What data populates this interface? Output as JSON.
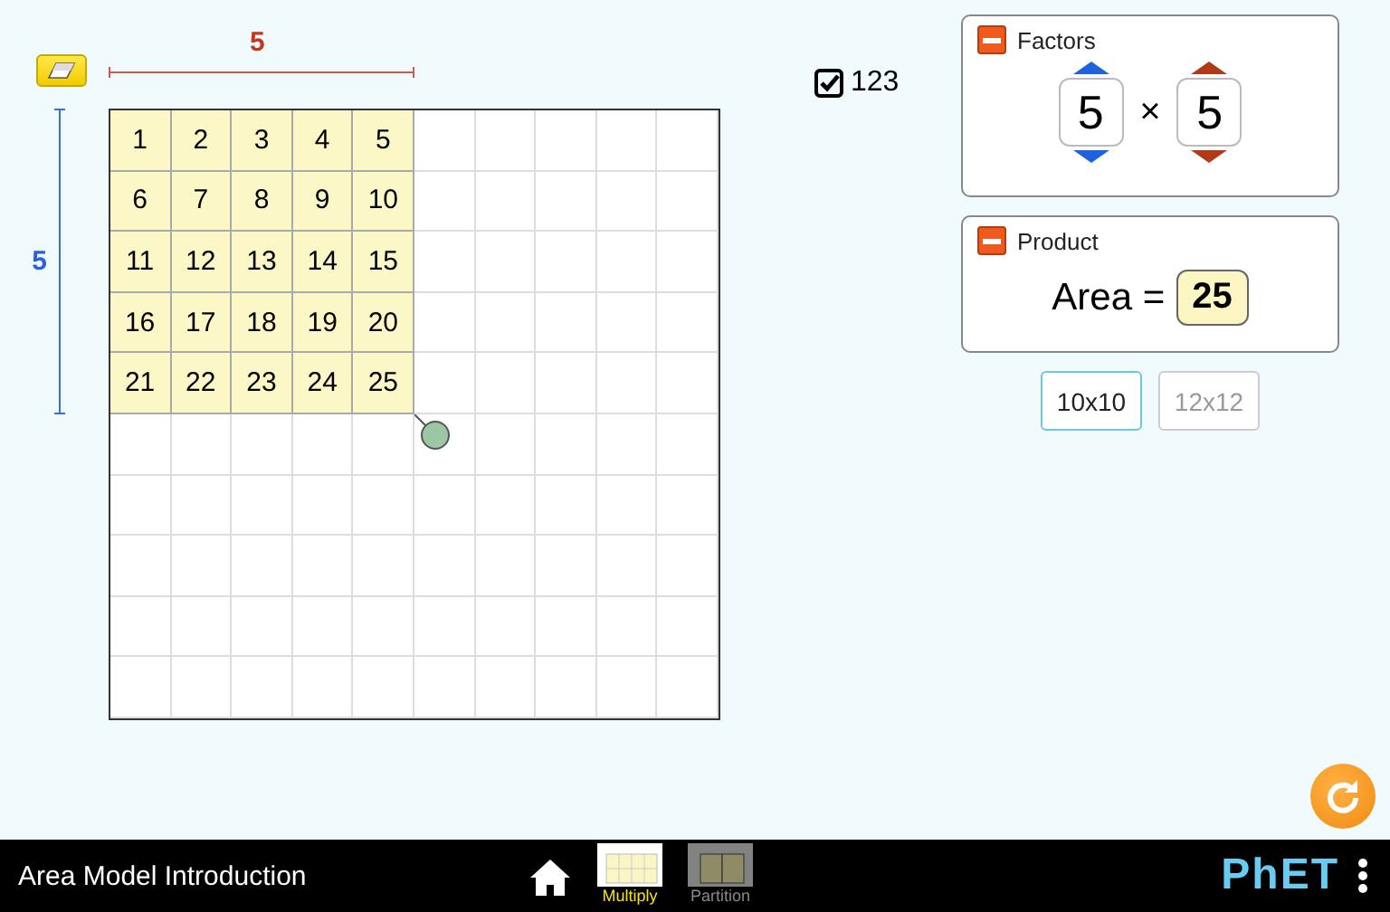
{
  "dimensions": {
    "width_label": "5",
    "height_label": "5"
  },
  "toggle": {
    "label": "123",
    "checked": true
  },
  "grid": {
    "rows": [
      [
        {
          "label": "1",
          "filled": true
        },
        {
          "label": "2",
          "filled": true
        },
        {
          "label": "3",
          "filled": true
        },
        {
          "label": "4",
          "filled": true
        },
        {
          "label": "5",
          "filled": true
        },
        {
          "filled": false
        },
        {
          "filled": false
        },
        {
          "filled": false
        },
        {
          "filled": false
        },
        {
          "filled": false
        }
      ],
      [
        {
          "label": "6",
          "filled": true
        },
        {
          "label": "7",
          "filled": true
        },
        {
          "label": "8",
          "filled": true
        },
        {
          "label": "9",
          "filled": true
        },
        {
          "label": "10",
          "filled": true
        },
        {
          "filled": false
        },
        {
          "filled": false
        },
        {
          "filled": false
        },
        {
          "filled": false
        },
        {
          "filled": false
        }
      ],
      [
        {
          "label": "11",
          "filled": true
        },
        {
          "label": "12",
          "filled": true
        },
        {
          "label": "13",
          "filled": true
        },
        {
          "label": "14",
          "filled": true
        },
        {
          "label": "15",
          "filled": true
        },
        {
          "filled": false
        },
        {
          "filled": false
        },
        {
          "filled": false
        },
        {
          "filled": false
        },
        {
          "filled": false
        }
      ],
      [
        {
          "label": "16",
          "filled": true
        },
        {
          "label": "17",
          "filled": true
        },
        {
          "label": "18",
          "filled": true
        },
        {
          "label": "19",
          "filled": true
        },
        {
          "label": "20",
          "filled": true
        },
        {
          "filled": false
        },
        {
          "filled": false
        },
        {
          "filled": false
        },
        {
          "filled": false
        },
        {
          "filled": false
        }
      ],
      [
        {
          "label": "21",
          "filled": true
        },
        {
          "label": "22",
          "filled": true
        },
        {
          "label": "23",
          "filled": true
        },
        {
          "label": "24",
          "filled": true
        },
        {
          "label": "25",
          "filled": true
        },
        {
          "filled": false
        },
        {
          "filled": false
        },
        {
          "filled": false
        },
        {
          "filled": false
        },
        {
          "filled": false
        }
      ],
      [
        {
          "filled": false
        },
        {
          "filled": false
        },
        {
          "filled": false
        },
        {
          "filled": false
        },
        {
          "filled": false
        },
        {
          "filled": false
        },
        {
          "filled": false
        },
        {
          "filled": false
        },
        {
          "filled": false
        },
        {
          "filled": false
        }
      ],
      [
        {
          "filled": false
        },
        {
          "filled": false
        },
        {
          "filled": false
        },
        {
          "filled": false
        },
        {
          "filled": false
        },
        {
          "filled": false
        },
        {
          "filled": false
        },
        {
          "filled": false
        },
        {
          "filled": false
        },
        {
          "filled": false
        }
      ],
      [
        {
          "filled": false
        },
        {
          "filled": false
        },
        {
          "filled": false
        },
        {
          "filled": false
        },
        {
          "filled": false
        },
        {
          "filled": false
        },
        {
          "filled": false
        },
        {
          "filled": false
        },
        {
          "filled": false
        },
        {
          "filled": false
        }
      ],
      [
        {
          "filled": false
        },
        {
          "filled": false
        },
        {
          "filled": false
        },
        {
          "filled": false
        },
        {
          "filled": false
        },
        {
          "filled": false
        },
        {
          "filled": false
        },
        {
          "filled": false
        },
        {
          "filled": false
        },
        {
          "filled": false
        }
      ],
      [
        {
          "filled": false
        },
        {
          "filled": false
        },
        {
          "filled": false
        },
        {
          "filled": false
        },
        {
          "filled": false
        },
        {
          "filled": false
        },
        {
          "filled": false
        },
        {
          "filled": false
        },
        {
          "filled": false
        },
        {
          "filled": false
        }
      ]
    ]
  },
  "factors_panel": {
    "title": "Factors",
    "expanded": true,
    "operator": "×",
    "factors": [
      {
        "value": "5",
        "color": "#1f62e0"
      },
      {
        "value": "5",
        "color": "#b23a1a"
      }
    ]
  },
  "product_panel": {
    "title": "Product",
    "expanded": true,
    "label": "Area =",
    "value": "25"
  },
  "grid_sizes": [
    {
      "label": "10x10",
      "selected": true
    },
    {
      "label": "12x12",
      "selected": false
    }
  ],
  "nav_bar": {
    "title": "Area Model Introduction",
    "screens": [
      {
        "label": "Multiply",
        "selected": true
      },
      {
        "label": "Partition",
        "selected": false
      }
    ],
    "logo": "PhET"
  }
}
